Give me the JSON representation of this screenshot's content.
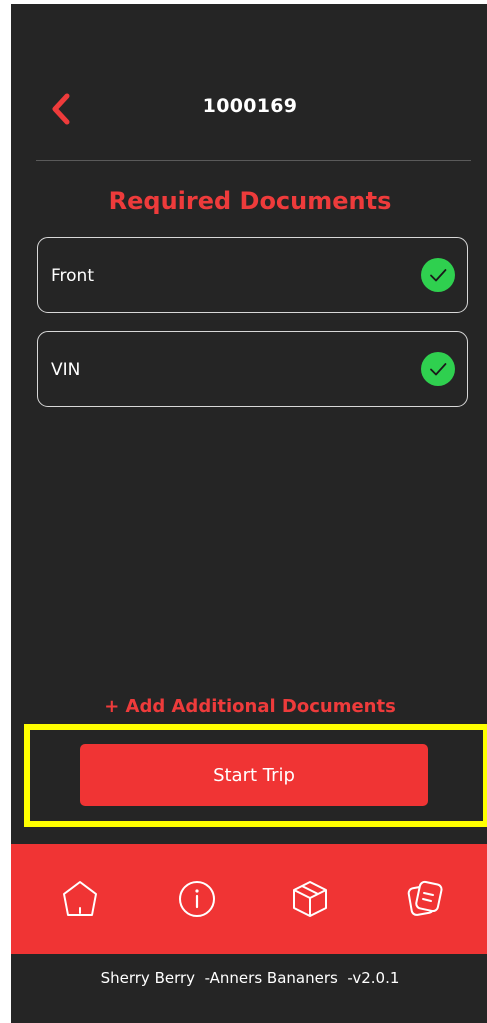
{
  "header": {
    "title": "1000169",
    "back_icon": "chevron-left-icon"
  },
  "section": {
    "title": "Required Documents"
  },
  "documents": [
    {
      "label": "Front",
      "status": "complete",
      "status_icon": "check-circle-icon"
    },
    {
      "label": "VIN",
      "status": "complete",
      "status_icon": "check-circle-icon"
    }
  ],
  "actions": {
    "add_documents_label": "+ Add Additional Documents",
    "start_trip_label": "Start Trip"
  },
  "tabbar": {
    "items": [
      {
        "icon": "home-icon"
      },
      {
        "icon": "info-icon"
      },
      {
        "icon": "package-icon"
      },
      {
        "icon": "documents-icon"
      }
    ]
  },
  "footer": {
    "text": "Sherry Berry  -Anners Bananers  -v2.0.1"
  },
  "colors": {
    "background": "#252525",
    "accent": "#f03434",
    "accent_text": "#ee3b3b",
    "success": "#2fd04f",
    "highlight": "#ffff00"
  }
}
